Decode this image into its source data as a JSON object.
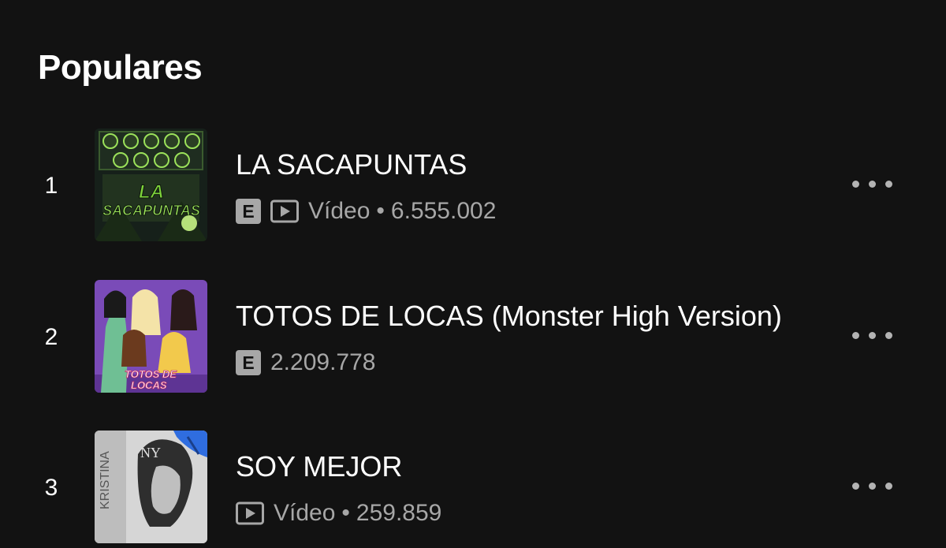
{
  "section": {
    "title": "Populares"
  },
  "tracks": [
    {
      "index": "1",
      "title": "LA SACAPUNTAS",
      "explicit": true,
      "explicit_label": "E",
      "video": true,
      "video_label": "Vídeo",
      "separator": "•",
      "plays": "6.555.002",
      "cover_text": "LA SACAPUNTAS",
      "cover_colors": [
        "#1c2a1a",
        "#3f7f2a",
        "#9be15a"
      ]
    },
    {
      "index": "2",
      "title": "TOTOS DE LOCAS (Monster High Version)",
      "explicit": true,
      "explicit_label": "E",
      "video": false,
      "plays": "2.209.778",
      "cover_text": "TOTOS DE LOCAS",
      "cover_colors": [
        "#6b3fa8",
        "#8a5cc6",
        "#f2c94c"
      ]
    },
    {
      "index": "3",
      "title": "SOY MEJOR",
      "explicit": false,
      "video": true,
      "video_label": "Vídeo",
      "separator": "•",
      "plays": "259.859",
      "cover_text": "KRISTINA",
      "cover_colors": [
        "#d9d9d9",
        "#3a3a3a",
        "#2f6de0"
      ]
    }
  ],
  "icons": {
    "video": "video-icon",
    "more": "more-options-icon",
    "explicit": "explicit-badge"
  },
  "colors": {
    "background": "#121212",
    "primary_text": "#ffffff",
    "secondary_text": "#a7a7a7"
  }
}
